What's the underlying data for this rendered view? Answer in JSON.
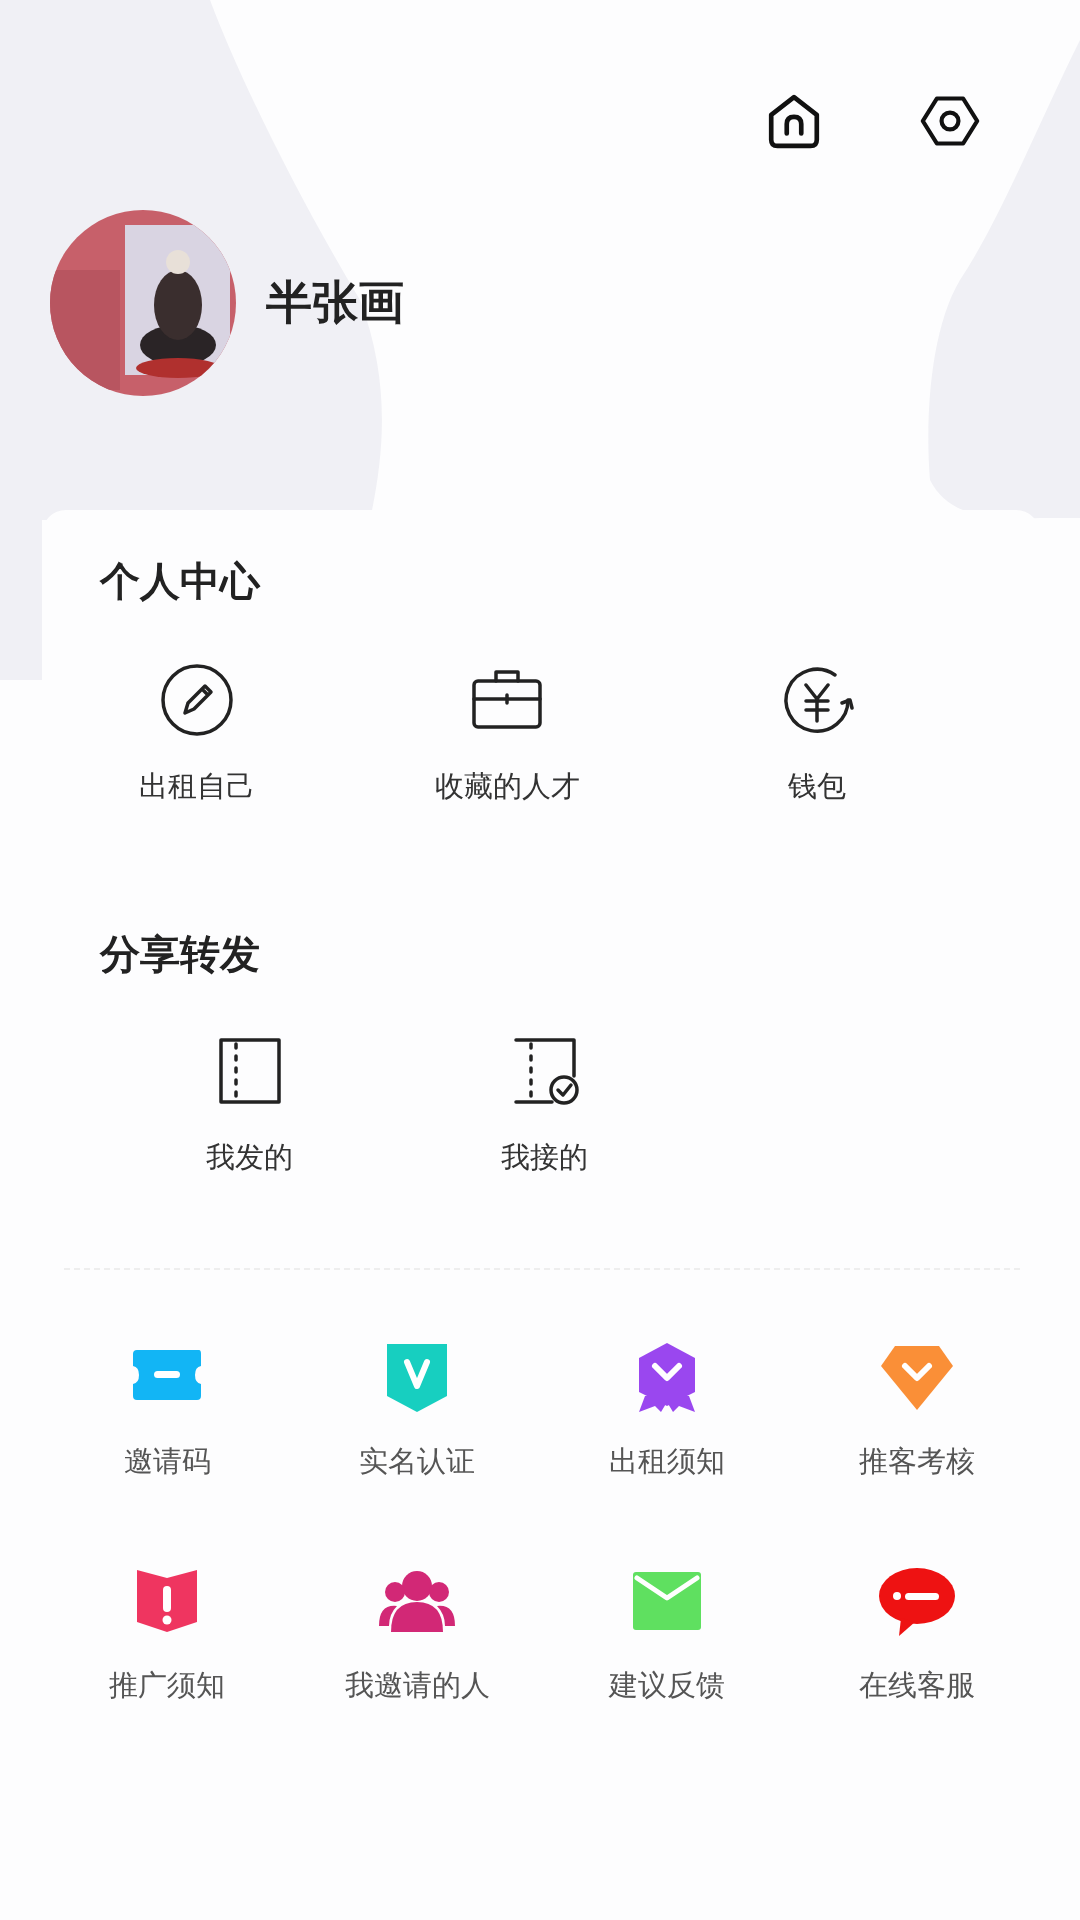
{
  "profile": {
    "name": "半张画"
  },
  "personal_center": {
    "title": "个人中心",
    "items": [
      {
        "label": "出租自己"
      },
      {
        "label": "收藏的人才"
      },
      {
        "label": "钱包"
      }
    ]
  },
  "share": {
    "title": "分享转发",
    "items": [
      {
        "label": "我发的"
      },
      {
        "label": "我接的"
      }
    ]
  },
  "services": [
    {
      "label": "邀请码"
    },
    {
      "label": "实名认证"
    },
    {
      "label": "出租须知"
    },
    {
      "label": "推客考核"
    },
    {
      "label": "推广须知"
    },
    {
      "label": "我邀请的人"
    },
    {
      "label": "建议反馈"
    },
    {
      "label": "在线客服"
    }
  ]
}
